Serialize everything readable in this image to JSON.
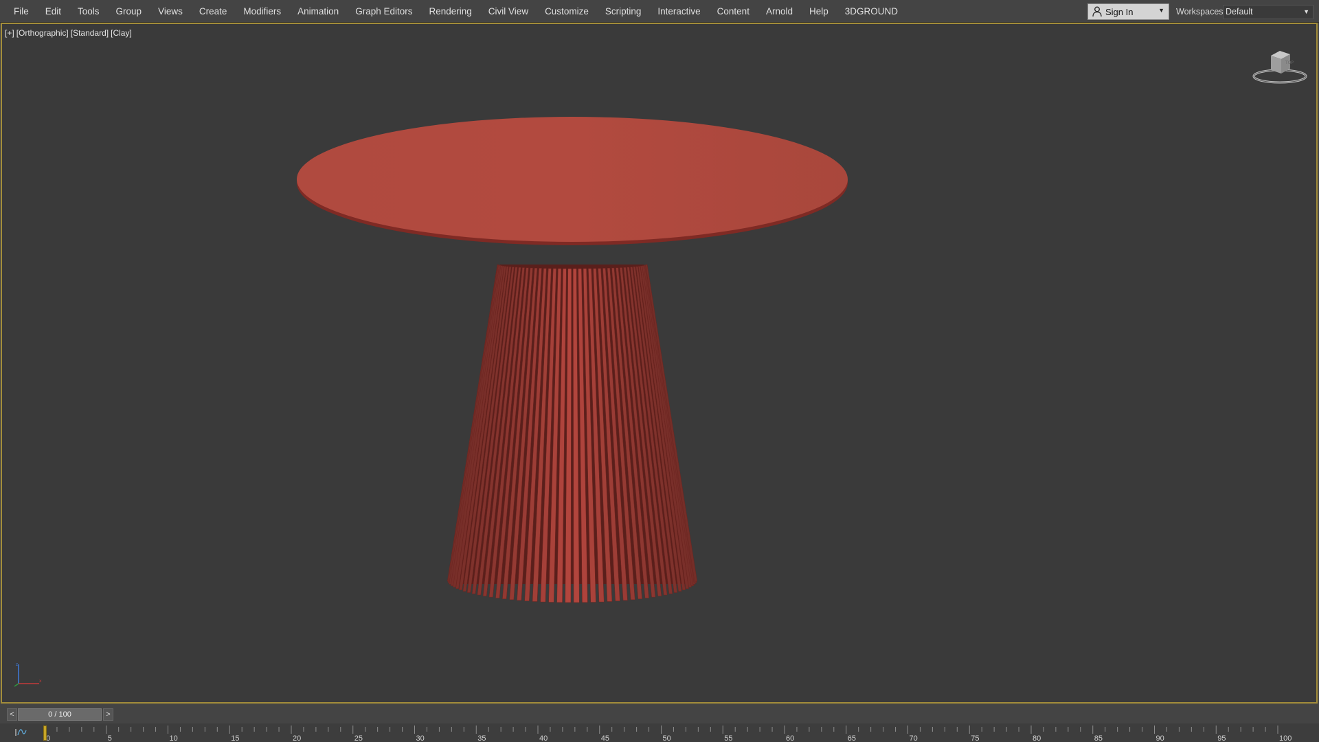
{
  "menubar": {
    "items": [
      "File",
      "Edit",
      "Tools",
      "Group",
      "Views",
      "Create",
      "Modifiers",
      "Animation",
      "Graph Editors",
      "Rendering",
      "Civil View",
      "Customize",
      "Scripting",
      "Interactive",
      "Content",
      "Arnold",
      "Help",
      "3DGROUND"
    ],
    "sign_in": "Sign In",
    "workspaces_label": "Workspaces:",
    "workspace_value": "Default"
  },
  "viewport": {
    "labels": [
      "[+]",
      "[Orthographic]",
      "[Standard]",
      "[Clay]"
    ],
    "clay_color": "#b5473d",
    "background_color": "#3a3a3a",
    "active_border_color": "#a38d3a"
  },
  "timeline": {
    "prev": "<",
    "next": ">",
    "frame_display": "0 / 100",
    "current_frame": 0,
    "total_frames": 100,
    "ruler_labels": [
      "0",
      "5",
      "10",
      "15",
      "20",
      "25",
      "30",
      "35",
      "40",
      "45",
      "50",
      "55",
      "60",
      "65",
      "70",
      "75",
      "80",
      "85",
      "90",
      "95",
      "100"
    ]
  },
  "icons": {
    "user": "user-icon",
    "viewcube": "viewcube-icon",
    "axis": "axis-tripod-icon",
    "curve": "curve-editor-icon"
  }
}
